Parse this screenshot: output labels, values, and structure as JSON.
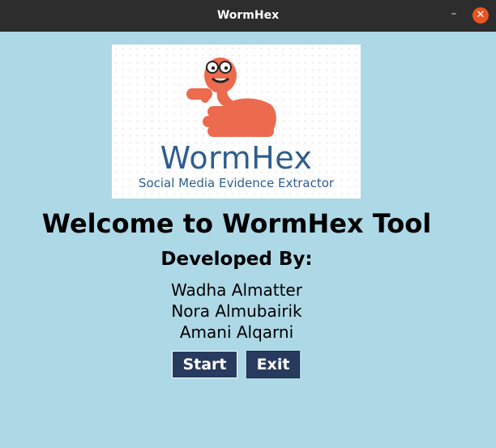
{
  "window": {
    "title": "WormHex",
    "minimize_glyph": "–",
    "close_glyph": "✕"
  },
  "logo": {
    "wordmark": "WormHex",
    "tagline": "Social Media Evidence Extractor",
    "icon": "worm-with-glasses-icon"
  },
  "main": {
    "welcome": "Welcome to WormHex Tool",
    "developed_by": "Developed By:",
    "developers": [
      "Wadha Almatter",
      "Nora Almubairik",
      "Amani Alqarni"
    ]
  },
  "buttons": {
    "start": "Start",
    "exit": "Exit"
  },
  "colors": {
    "background": "#add8e6",
    "titlebar": "#2d2d2d",
    "close_button": "#e95420",
    "button_bg": "#283a5e",
    "worm": "#ec6a4e",
    "wordmark": "#2f5e8e"
  }
}
